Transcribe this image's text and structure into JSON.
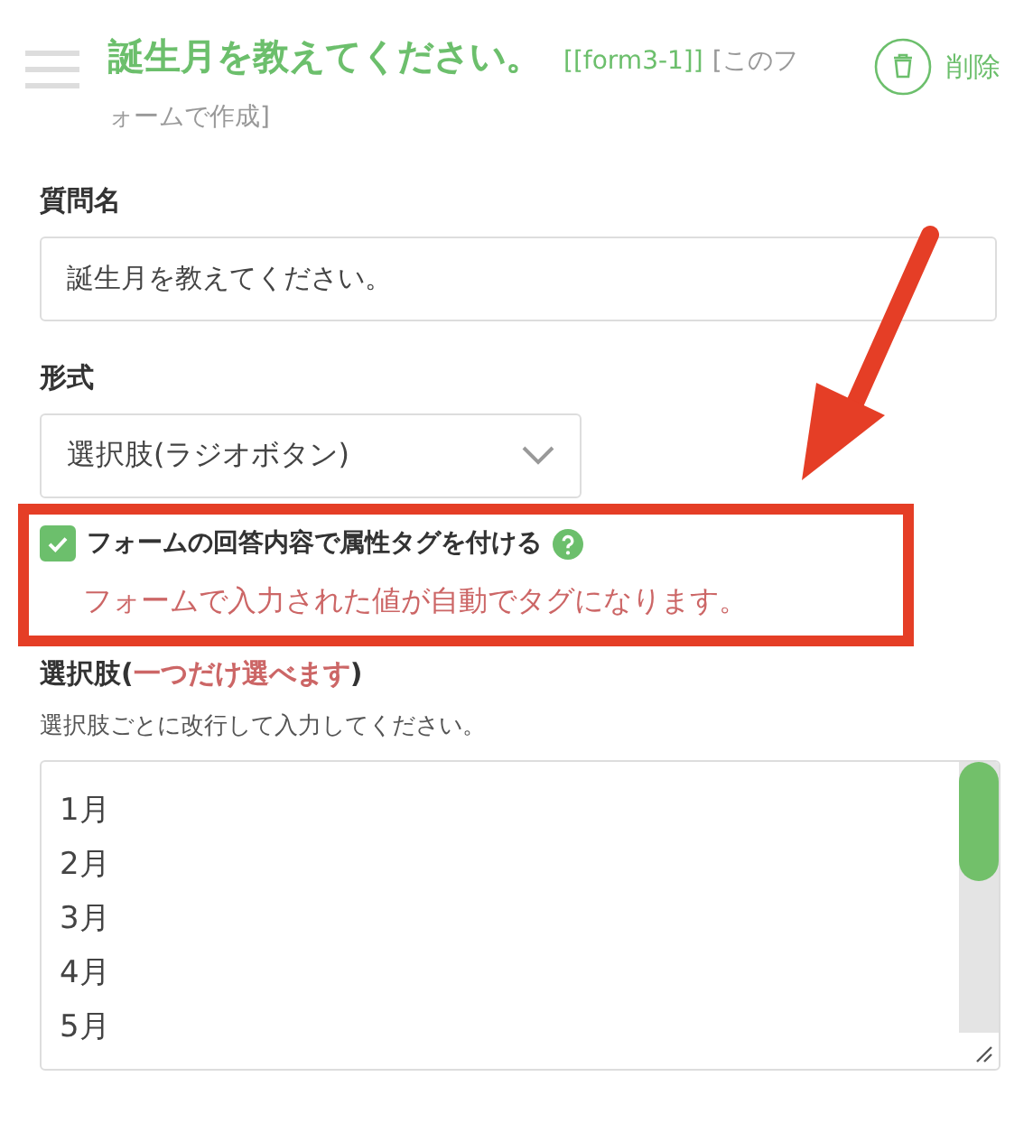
{
  "header": {
    "title": "誕生月を教えてください。",
    "form_code": "[[form3-1]]",
    "source": "[このフォームで作成]",
    "delete_label": "削除"
  },
  "question_name": {
    "label": "質問名",
    "value": "誕生月を教えてください。"
  },
  "format": {
    "label": "形式",
    "value": "選択肢(ラジオボタン)"
  },
  "attribute_tag": {
    "label": "フォームの回答内容で属性タグを付ける",
    "checked": true,
    "note": "フォームで入力された値が自動でタグになります。",
    "highlighted": true
  },
  "choices": {
    "label": "選択肢(*一つだけ選べます*)",
    "hint": "選択肢ごとに改行して入力してください。",
    "lines": [
      "1月",
      "2月",
      "3月",
      "4月",
      "5月"
    ]
  }
}
